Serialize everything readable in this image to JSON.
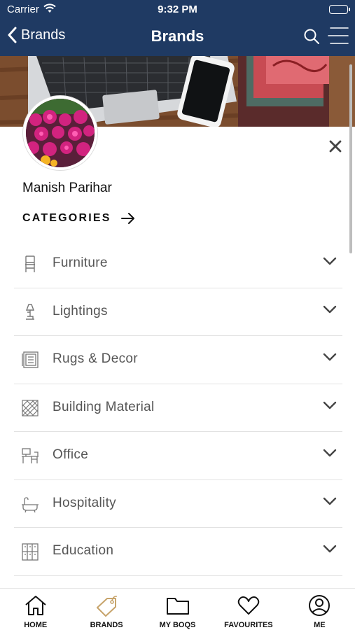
{
  "status_bar": {
    "carrier": "Carrier",
    "time": "9:32 PM"
  },
  "navbar": {
    "back_label": "Brands",
    "title": "Brands"
  },
  "profile": {
    "name": "Manish Parihar"
  },
  "categories": {
    "heading": "CATEGORIES",
    "items": [
      {
        "label": "Furniture",
        "icon": "chair-icon"
      },
      {
        "label": "Lightings",
        "icon": "lamp-icon"
      },
      {
        "label": "Rugs & Decor",
        "icon": "rug-icon"
      },
      {
        "label": "Building Material",
        "icon": "tile-pattern-icon"
      },
      {
        "label": "Office",
        "icon": "desk-icon"
      },
      {
        "label": "Hospitality",
        "icon": "bathtub-icon"
      },
      {
        "label": "Education",
        "icon": "locker-icon"
      }
    ]
  },
  "tabbar": {
    "tabs": [
      {
        "label": "HOME",
        "icon": "home-icon"
      },
      {
        "label": "BRANDS",
        "icon": "tag-icon",
        "active": true
      },
      {
        "label": "MY BOQS",
        "icon": "folder-icon"
      },
      {
        "label": "FAVOURITES",
        "icon": "heart-icon"
      },
      {
        "label": "ME",
        "icon": "user-circle-icon"
      }
    ]
  },
  "colors": {
    "header": "#1f3a63",
    "active_tab": "#c7a46b",
    "text_muted": "#555555"
  }
}
